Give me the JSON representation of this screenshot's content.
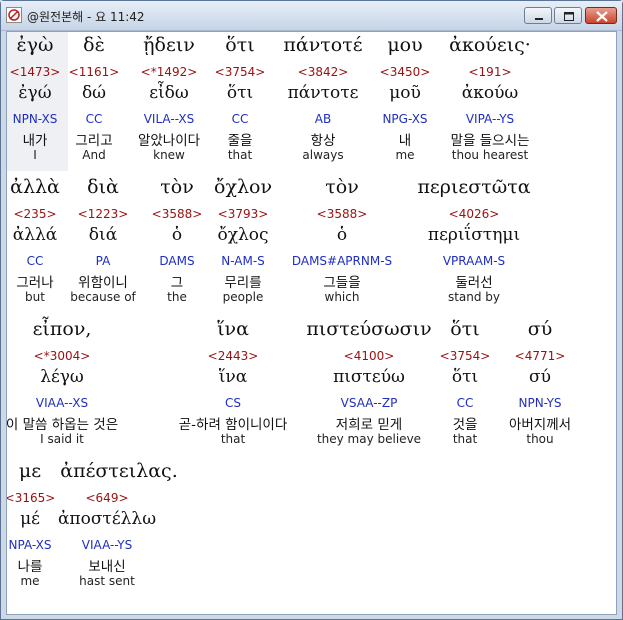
{
  "window": {
    "title": "@원전본해 - 요 11:42",
    "controls": {
      "minimize": "minimize-icon",
      "maximize": "maximize-icon",
      "close": "close-icon"
    }
  },
  "words": [
    {
      "greek": "ἐγὼ",
      "strong": "<1473>",
      "lemma": "ἐγώ",
      "morph": "NPN-XS",
      "korean": "내가",
      "english": "I"
    },
    {
      "greek": "δὲ",
      "strong": "<1161>",
      "lemma": "δώ",
      "morph": "CC",
      "korean": "그리고",
      "english": "And"
    },
    {
      "greek": "ᾔδειν",
      "strong": "<*1492>",
      "lemma": "εἶδω",
      "morph": "VILA--XS",
      "korean": "알았나이다",
      "english": "knew"
    },
    {
      "greek": "ὅτι",
      "strong": "<3754>",
      "lemma": "ὅτι",
      "morph": "CC",
      "korean": "줄을",
      "english": "that"
    },
    {
      "greek": "πάντοτέ",
      "strong": "<3842>",
      "lemma": "πάντοτε",
      "morph": "AB",
      "korean": "항상",
      "english": "always"
    },
    {
      "greek": "μου",
      "strong": "<3450>",
      "lemma": "μοῦ",
      "morph": "NPG-XS",
      "korean": "내",
      "english": "me"
    },
    {
      "greek": "ἀκούεις·",
      "strong": "<191>",
      "lemma": "ἀκούω",
      "morph": "VIPA--YS",
      "korean": "말을 들으시는",
      "english": "thou hearest"
    },
    {
      "greek": "ἀλλὰ",
      "strong": "<235>",
      "lemma": "ἀλλά",
      "morph": "CC",
      "korean": "그러나",
      "english": "but"
    },
    {
      "greek": "διὰ",
      "strong": "<1223>",
      "lemma": "διά",
      "morph": "PA",
      "korean": "위함이니",
      "english": "because of"
    },
    {
      "greek": "τὸν",
      "strong": "<3588>",
      "lemma": "ὁ",
      "morph": "DAMS",
      "korean": "그",
      "english": "the"
    },
    {
      "greek": "ὄχλον",
      "strong": "<3793>",
      "lemma": "ὄχλος",
      "morph": "N-AM-S",
      "korean": "무리를",
      "english": "people"
    },
    {
      "greek": "τὸν",
      "strong": "<3588>",
      "lemma": "ὁ",
      "morph": "DAMS#APRNM-S",
      "korean": "그들을",
      "english": "which"
    },
    {
      "greek": "περιεστῶτα",
      "strong": "<4026>",
      "lemma": "περιΐστημι",
      "morph": "VPRAAM-S",
      "korean": "둘러선",
      "english": "stand by"
    },
    {
      "greek": "εἶπον,",
      "strong": "<*3004>",
      "lemma": "λέγω",
      "morph": "VIAA--XS",
      "korean": "이 말씀 하옵는 것은",
      "english": "I said it"
    },
    {
      "greek": "ἵνα",
      "strong": "<2443>",
      "lemma": "ἵνα",
      "morph": "CS",
      "korean": "곧-하려 함이니이다",
      "english": "that"
    },
    {
      "greek": "πιστεύσωσιν",
      "strong": "<4100>",
      "lemma": "πιστεύω",
      "morph": "VSAA--ZP",
      "korean": "저희로 믿게",
      "english": "they may believe"
    },
    {
      "greek": "ὅτι",
      "strong": "<3754>",
      "lemma": "ὅτι",
      "morph": "CC",
      "korean": "것을",
      "english": "that"
    },
    {
      "greek": "σύ",
      "strong": "<4771>",
      "lemma": "σύ",
      "morph": "NPN-YS",
      "korean": "아버지께서",
      "english": "thou"
    },
    {
      "greek": "με",
      "strong": "<3165>",
      "lemma": "μέ",
      "morph": "NPA-XS",
      "korean": "나를",
      "english": "me"
    },
    {
      "greek": "ἀπέστειλας.",
      "strong": "<649>",
      "lemma": "ἀποστέλλω",
      "morph": "VIAA--YS",
      "korean": "보내신",
      "english": "hast sent"
    }
  ]
}
